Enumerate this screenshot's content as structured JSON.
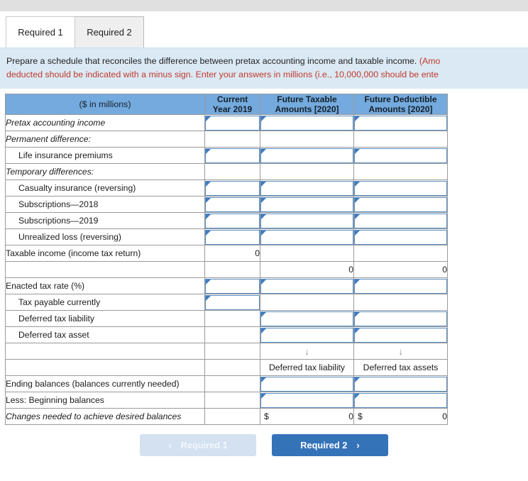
{
  "tabs": [
    {
      "label": "Required 1",
      "active": true
    },
    {
      "label": "Required 2",
      "active": false
    }
  ],
  "instruction": {
    "line1_plain": "Prepare a schedule that reconciles the difference between pretax accounting income and taxable income. ",
    "line1_warn": "(Amo",
    "line2_warn": "deducted should be indicated with a minus sign. Enter your answers in millions (i.e., 10,000,000 should be ente"
  },
  "table": {
    "headers": {
      "label": "($ in millions)",
      "current": "Current\nYear 2019",
      "current_l1": "Current",
      "current_l2": "Year 2019",
      "future_taxable_l1": "Future Taxable",
      "future_taxable_l2": "Amounts [2020]",
      "future_deductible_l1": "Future Deductible",
      "future_deductible_l2": "Amounts [2020]"
    },
    "rows": [
      {
        "label": "Pretax accounting income",
        "style": "ital",
        "cur": "input",
        "ftx": "input",
        "fdd": "input"
      },
      {
        "label": "Permanent difference:",
        "style": "ital",
        "cur": "",
        "ftx": "",
        "fdd": ""
      },
      {
        "label": "Life insurance premiums",
        "style": "ind",
        "cur": "input",
        "ftx": "input",
        "fdd": "input"
      },
      {
        "label": "Temporary differences:",
        "style": "ital",
        "cur": "",
        "ftx": "",
        "fdd": ""
      },
      {
        "label": "Casualty insurance (reversing)",
        "style": "ind",
        "cur": "input",
        "ftx": "input",
        "fdd": "input"
      },
      {
        "label": "Subscriptions—2018",
        "style": "ind",
        "cur": "input",
        "ftx": "input",
        "fdd": "input"
      },
      {
        "label": "Subscriptions—2019",
        "style": "ind",
        "cur": "input",
        "ftx": "input",
        "fdd": "input"
      },
      {
        "label": "Unrealized loss (reversing)",
        "style": "ind",
        "cur": "input",
        "ftx": "input",
        "fdd": "input"
      },
      {
        "label": "Taxable income (income tax return)",
        "style": "",
        "cur": "0",
        "ftx": "",
        "fdd": ""
      },
      {
        "label": "",
        "style": "",
        "cur": "",
        "ftx": "0",
        "fdd": "0"
      },
      {
        "label": "Enacted tax rate (%)",
        "style": "",
        "cur": "input",
        "ftx": "input",
        "fdd": "input"
      },
      {
        "label": "Tax payable currently",
        "style": "ind",
        "cur": "input",
        "ftx": "",
        "fdd": ""
      },
      {
        "label": "Deferred tax liability",
        "style": "ind",
        "cur": "",
        "ftx": "input",
        "fdd": "input"
      },
      {
        "label": "Deferred tax asset",
        "style": "ind",
        "cur": "",
        "ftx": "input",
        "fdd": "input"
      },
      {
        "label": "",
        "style": "",
        "cur": "",
        "ftx": "↓",
        "fdd": "↓"
      },
      {
        "label": "",
        "style": "",
        "cur": "",
        "ftx": "Deferred tax liability",
        "fdd": "Deferred tax assets"
      },
      {
        "label": "Ending balances (balances currently needed)",
        "style": "",
        "cur": "",
        "ftx": "input",
        "fdd": "input"
      },
      {
        "label": "Less: Beginning balances",
        "style": "",
        "cur": "",
        "ftx": "input",
        "fdd": "input"
      },
      {
        "label": "Changes needed to achieve desired balances",
        "style": "ital",
        "cur": "",
        "ftx": "$|0",
        "fdd": "$|0"
      }
    ]
  },
  "nav": {
    "prev_label": "Required 1",
    "prev_chevron": "‹",
    "next_label": "Required 2",
    "next_chevron": "›"
  },
  "colors": {
    "header_blue": "#74aadd",
    "banner_blue": "#dbe9f4",
    "warn_red": "#c0392b",
    "input_border": "#5b8fc4",
    "primary_button": "#3573b9"
  }
}
